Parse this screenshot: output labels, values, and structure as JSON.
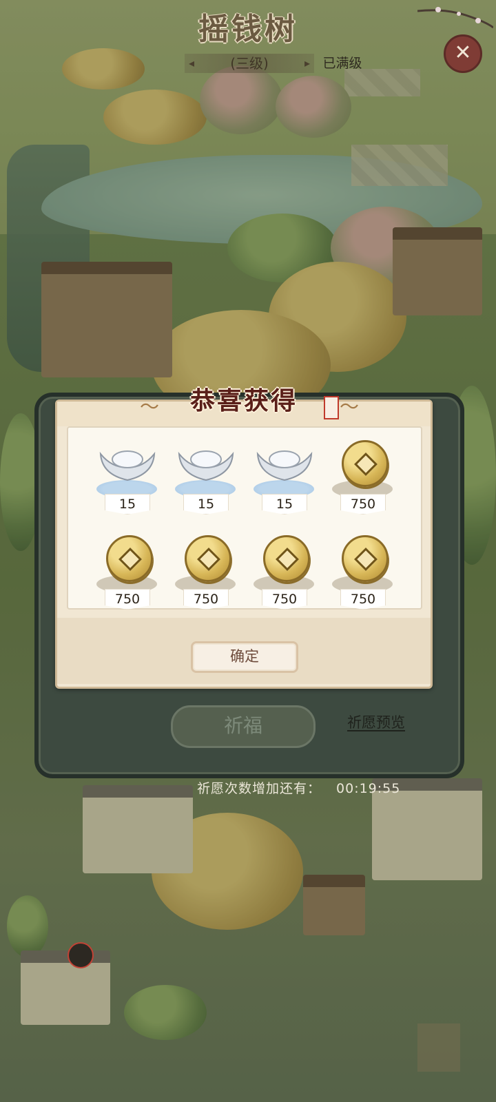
{
  "header": {
    "title": "摇钱树",
    "level": "(三级)",
    "max_badge": "已满级",
    "close_icon": "close-icon"
  },
  "reward_dialog": {
    "title": "恭喜获得",
    "items": [
      {
        "icon": "silver-ingot-icon",
        "count": "15"
      },
      {
        "icon": "silver-ingot-icon",
        "count": "15"
      },
      {
        "icon": "silver-ingot-icon",
        "count": "15"
      },
      {
        "icon": "copper-coin-icon",
        "count": "750"
      },
      {
        "icon": "copper-coin-icon",
        "count": "750"
      },
      {
        "icon": "copper-coin-icon",
        "count": "750"
      },
      {
        "icon": "copper-coin-icon",
        "count": "750"
      },
      {
        "icon": "copper-coin-icon",
        "count": "750"
      }
    ],
    "confirm_label": "确定"
  },
  "panel": {
    "pray_label": "祈福",
    "preview_label": "祈愿预览",
    "timer_label": "祈愿次数增加还有：",
    "timer_value": "00:19:55"
  }
}
